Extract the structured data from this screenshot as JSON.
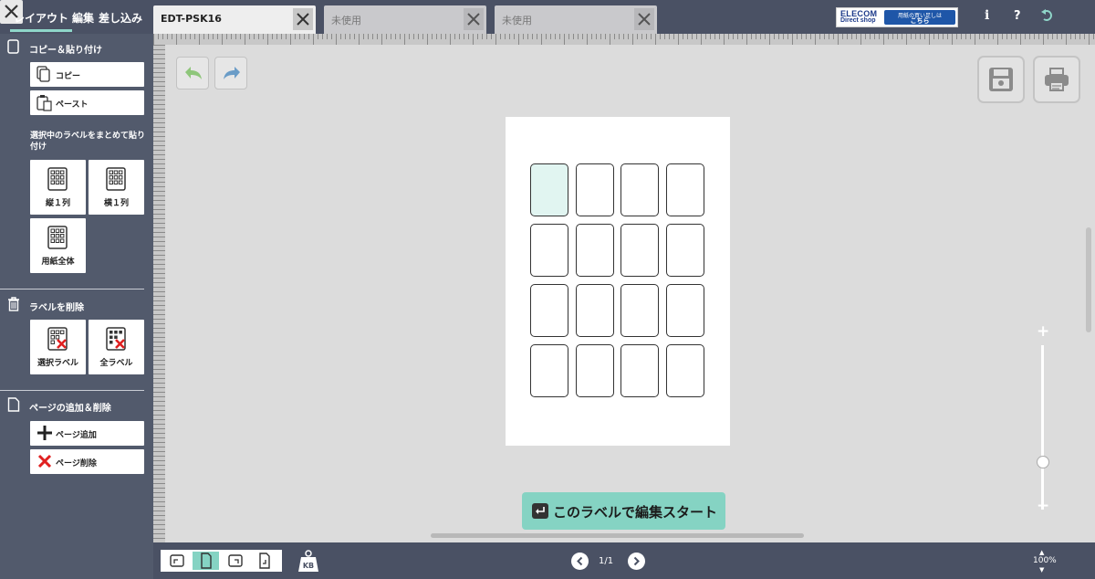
{
  "menu": {
    "layout": "レイアウト",
    "edit": "編集",
    "merge": "差し込み"
  },
  "tabs": [
    {
      "label": "EDT-PSK16",
      "active": true
    },
    {
      "label": "未使用",
      "active": false
    },
    {
      "label": "未使用",
      "active": false
    }
  ],
  "banner": {
    "brand": "ELECOM",
    "sub": "Direct shop",
    "line1": "用紙の買い足しは",
    "line2": "こちら"
  },
  "top_icons": {
    "info": "i",
    "help": "?"
  },
  "sidebar": {
    "copy_paste": {
      "title": "コピー＆貼り付け",
      "copy": "コピー",
      "paste": "ペースト"
    },
    "merge_note": "選択中のラベルをまとめて貼り付け",
    "merge": {
      "vertical": "縦１列",
      "horizontal": "横１列",
      "whole": "用紙全体"
    },
    "delete": {
      "title": "ラベルを削除",
      "selected": "選択ラベル",
      "all": "全ラベル"
    },
    "page": {
      "title": "ページの追加＆削除",
      "add": "ページ追加",
      "remove": "ページ削除"
    }
  },
  "start_button": "このラベルで編集スタート",
  "pager": {
    "label": "1/1"
  },
  "zoom": {
    "value": "100%",
    "plus": "+",
    "minus": "−",
    "level_percent": 100
  },
  "size_badge": "KB",
  "colors": {
    "accent": "#85d3c3",
    "bar": "#4a5164",
    "sidebar": "#525a6c",
    "selected_label": "#e1f5f1"
  }
}
